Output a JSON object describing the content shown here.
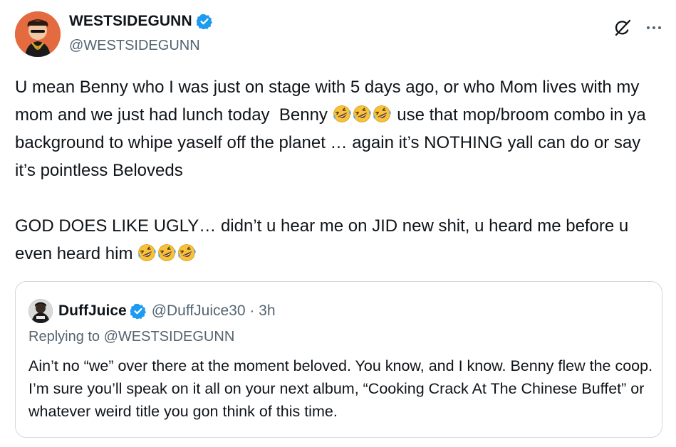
{
  "author": {
    "display_name": "WESTSIDEGUNN",
    "handle": "@WESTSIDEGUNN",
    "verified_color": "#1d9bf0"
  },
  "tweet": {
    "paragraph1_a": "U mean Benny who I was just on stage with 5 days ago, or who Mom lives with my mom and we just had lunch today  Benny ",
    "paragraph1_emojis": [
      "rolling-on-floor-laughing",
      "rolling-on-floor-laughing",
      "rolling-on-floor-laughing"
    ],
    "paragraph1_b": " use that mop/broom combo in ya background to whipe yaself off the planet … again it’s NOTHING yall can do or say it’s pointless Beloveds",
    "paragraph2_a": "GOD DOES LIKE UGLY… didn’t u hear me on JID new shit, u heard me before u even heard him ",
    "paragraph2_emojis": [
      "rolling-on-floor-laughing",
      "rolling-on-floor-laughing",
      "rolling-on-floor-laughing"
    ]
  },
  "quote": {
    "display_name": "DuffJuice",
    "handle_time": "@DuffJuice30 · 3h",
    "replying_to": "Replying to @WESTSIDEGUNN",
    "text": "Ain’t no “we” over there at the moment beloved. You know, and I know. Benny flew the coop. I’m sure you’ll speak on it all on your next album, “Cooking Crack At The Chinese Buffet” or whatever weird title you gon think of this time."
  },
  "icons": {
    "verified": "verified-badge-icon",
    "grok": "grok-icon",
    "more": "more-options-icon"
  }
}
